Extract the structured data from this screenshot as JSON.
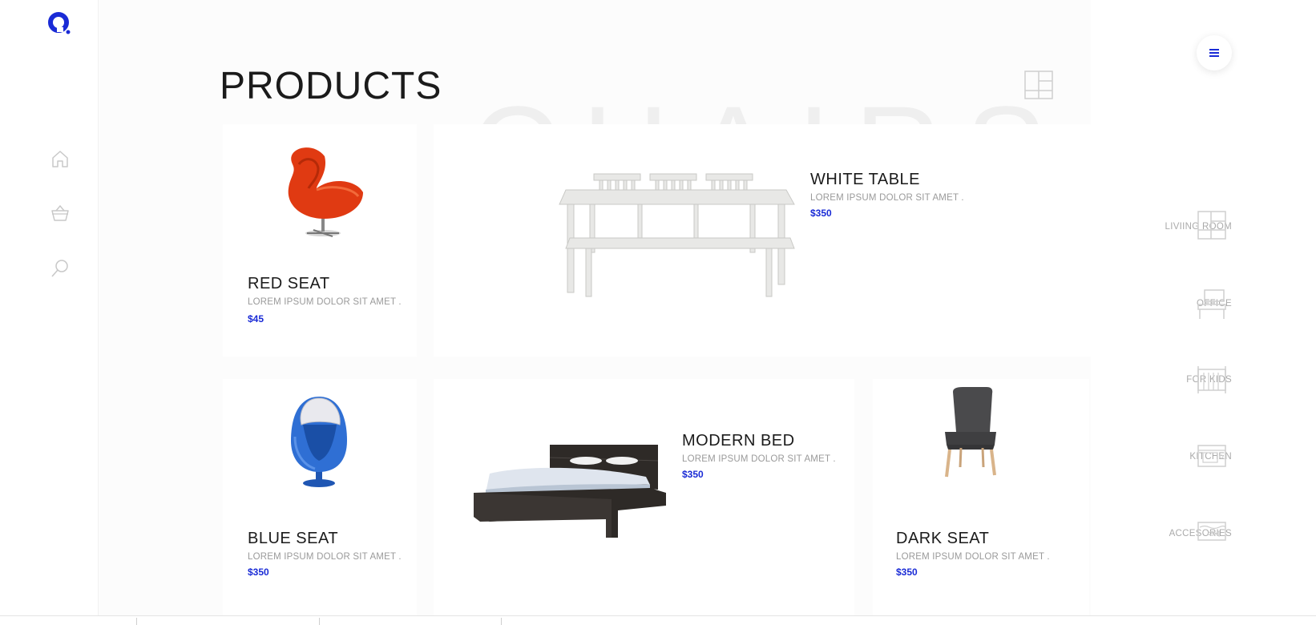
{
  "page": {
    "title": "PRODUCTS"
  },
  "colors": {
    "accent": "#1a2bd6",
    "text": "#1b1b1b",
    "muted": "#9a9a9a",
    "background": "#fcfcfc"
  },
  "left_nav": {
    "items": [
      {
        "icon": "home-icon"
      },
      {
        "icon": "basket-icon"
      },
      {
        "icon": "search-icon"
      }
    ]
  },
  "products": [
    {
      "name": "RED SEAT",
      "description": "LOREM IPSUM DOLOR SIT AMET .",
      "price": "$45",
      "image": "red-egg-chair"
    },
    {
      "name": "WHITE TABLE",
      "description": "LOREM IPSUM DOLOR SIT AMET .",
      "price": "$350",
      "image": "white-dining-table"
    },
    {
      "name": "BLUE SEAT",
      "description": "LOREM IPSUM DOLOR SIT AMET .",
      "price": "$350",
      "image": "blue-pod-chair"
    },
    {
      "name": "MODERN BED",
      "description": "LOREM IPSUM DOLOR SIT AMET .",
      "price": "$350",
      "image": "dark-bed"
    },
    {
      "name": "DARK SEAT",
      "description": "LOREM IPSUM DOLOR SIT AMET .",
      "price": "$350",
      "image": "dark-chair"
    }
  ],
  "right_nav": {
    "menu_icon": "hamburger-icon",
    "categories": [
      {
        "label": "LIVIING ROOM",
        "icon": "shelf-icon"
      },
      {
        "label": "OFFICE",
        "icon": "desk-icon"
      },
      {
        "label": "FOR KIDS",
        "icon": "crib-icon"
      },
      {
        "label": "KITCHEN",
        "icon": "stove-icon"
      },
      {
        "label": "ACCESORIES",
        "icon": "aquarium-icon"
      }
    ]
  }
}
